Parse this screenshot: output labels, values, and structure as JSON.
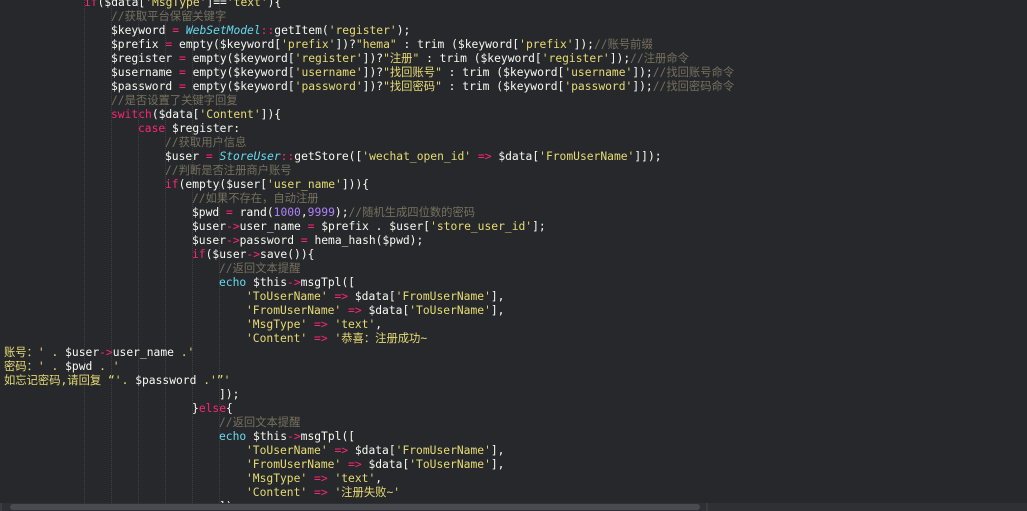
{
  "editor": {
    "lines": [
      {
        "tokens": [
          {
            "c": "t-kw",
            "t": "if"
          },
          {
            "c": "t-plain",
            "t": "($data["
          },
          {
            "c": "t-str",
            "t": "'MsgType'"
          },
          {
            "c": "t-plain",
            "t": "]=="
          },
          {
            "c": "t-str",
            "t": "'text'"
          },
          {
            "c": "t-plain",
            "t": "){"
          }
        ]
      },
      {
        "tokens": [
          {
            "c": "t-cmt",
            "t": "//获取平台保留关键字"
          }
        ]
      },
      {
        "tokens": [
          {
            "c": "t-plain",
            "t": "$keyword "
          },
          {
            "c": "t-op",
            "t": "="
          },
          {
            "c": "t-plain",
            "t": " "
          },
          {
            "c": "t-cls",
            "t": "WebSetModel"
          },
          {
            "c": "t-op",
            "t": "::"
          },
          {
            "c": "t-plain",
            "t": "getItem("
          },
          {
            "c": "t-str",
            "t": "'register'"
          },
          {
            "c": "t-plain",
            "t": ");"
          }
        ]
      },
      {
        "tokens": [
          {
            "c": "t-plain",
            "t": "$prefix "
          },
          {
            "c": "t-op",
            "t": "="
          },
          {
            "c": "t-plain",
            "t": " empty($keyword["
          },
          {
            "c": "t-str",
            "t": "'prefix'"
          },
          {
            "c": "t-plain",
            "t": "])?"
          },
          {
            "c": "t-str",
            "t": "\"hema\""
          },
          {
            "c": "t-plain",
            "t": " : trim ($keyword["
          },
          {
            "c": "t-str",
            "t": "'prefix'"
          },
          {
            "c": "t-plain",
            "t": "]);"
          },
          {
            "c": "t-cmt",
            "t": "//账号前缀"
          }
        ]
      },
      {
        "tokens": [
          {
            "c": "t-plain",
            "t": "$register "
          },
          {
            "c": "t-op",
            "t": "="
          },
          {
            "c": "t-plain",
            "t": " empty($keyword["
          },
          {
            "c": "t-str",
            "t": "'register'"
          },
          {
            "c": "t-plain",
            "t": "])?"
          },
          {
            "c": "t-str",
            "t": "\"注册\""
          },
          {
            "c": "t-plain",
            "t": " : trim ($keyword["
          },
          {
            "c": "t-str",
            "t": "'register'"
          },
          {
            "c": "t-plain",
            "t": "]);"
          },
          {
            "c": "t-cmt",
            "t": "//注册命令"
          }
        ]
      },
      {
        "tokens": [
          {
            "c": "t-plain",
            "t": "$username "
          },
          {
            "c": "t-op",
            "t": "="
          },
          {
            "c": "t-plain",
            "t": " empty($keyword["
          },
          {
            "c": "t-str",
            "t": "'username'"
          },
          {
            "c": "t-plain",
            "t": "])?"
          },
          {
            "c": "t-str",
            "t": "\"找回账号\""
          },
          {
            "c": "t-plain",
            "t": " : trim ($keyword["
          },
          {
            "c": "t-str",
            "t": "'username'"
          },
          {
            "c": "t-plain",
            "t": "]);"
          },
          {
            "c": "t-cmt",
            "t": "//找回账号命令"
          }
        ]
      },
      {
        "tokens": [
          {
            "c": "t-plain",
            "t": "$password "
          },
          {
            "c": "t-op",
            "t": "="
          },
          {
            "c": "t-plain",
            "t": " empty($keyword["
          },
          {
            "c": "t-str",
            "t": "'password'"
          },
          {
            "c": "t-plain",
            "t": "])?"
          },
          {
            "c": "t-str",
            "t": "\"找回密码\""
          },
          {
            "c": "t-plain",
            "t": " : trim ($keyword["
          },
          {
            "c": "t-str",
            "t": "'password'"
          },
          {
            "c": "t-plain",
            "t": "]);"
          },
          {
            "c": "t-cmt",
            "t": "//找回密码命令"
          }
        ]
      },
      {
        "tokens": [
          {
            "c": "t-cmt",
            "t": "//是否设置了关键字回复"
          }
        ]
      },
      {
        "tokens": [
          {
            "c": "t-kw",
            "t": "switch"
          },
          {
            "c": "t-plain",
            "t": "($data["
          },
          {
            "c": "t-str",
            "t": "'Content'"
          },
          {
            "c": "t-plain",
            "t": "]){"
          }
        ]
      },
      {
        "tokens": [
          {
            "c": "t-kw",
            "t": "case"
          },
          {
            "c": "t-plain",
            "t": " $register:"
          }
        ]
      },
      {
        "tokens": [
          {
            "c": "t-cmt",
            "t": "//获取用户信息"
          }
        ]
      },
      {
        "tokens": [
          {
            "c": "t-plain",
            "t": "$user "
          },
          {
            "c": "t-op",
            "t": "="
          },
          {
            "c": "t-plain",
            "t": " "
          },
          {
            "c": "t-cls",
            "t": "StoreUser"
          },
          {
            "c": "t-op",
            "t": "::"
          },
          {
            "c": "t-plain",
            "t": "getStore(["
          },
          {
            "c": "t-str",
            "t": "'wechat_open_id'"
          },
          {
            "c": "t-plain",
            "t": " "
          },
          {
            "c": "t-op",
            "t": "=>"
          },
          {
            "c": "t-plain",
            "t": " $data["
          },
          {
            "c": "t-str",
            "t": "'FromUserName'"
          },
          {
            "c": "t-plain",
            "t": "]]);"
          }
        ]
      },
      {
        "tokens": [
          {
            "c": "t-cmt",
            "t": "//判断是否注册商户账号"
          }
        ]
      },
      {
        "tokens": [
          {
            "c": "t-kw",
            "t": "if"
          },
          {
            "c": "t-plain",
            "t": "(empty($user["
          },
          {
            "c": "t-str",
            "t": "'user_name'"
          },
          {
            "c": "t-plain",
            "t": "])){"
          }
        ]
      },
      {
        "tokens": [
          {
            "c": "t-cmt",
            "t": "//如果不存在，自动注册"
          }
        ]
      },
      {
        "tokens": [
          {
            "c": "t-plain",
            "t": "$pwd "
          },
          {
            "c": "t-op",
            "t": "="
          },
          {
            "c": "t-plain",
            "t": " rand("
          },
          {
            "c": "t-num",
            "t": "1000"
          },
          {
            "c": "t-plain",
            "t": ","
          },
          {
            "c": "t-num",
            "t": "9999"
          },
          {
            "c": "t-plain",
            "t": ");"
          },
          {
            "c": "t-cmt",
            "t": "//随机生成四位数的密码"
          }
        ]
      },
      {
        "tokens": [
          {
            "c": "t-plain",
            "t": "$user"
          },
          {
            "c": "t-op",
            "t": "->"
          },
          {
            "c": "t-plain",
            "t": "user_name "
          },
          {
            "c": "t-op",
            "t": "="
          },
          {
            "c": "t-plain",
            "t": " $prefix . $user["
          },
          {
            "c": "t-str",
            "t": "'store_user_id'"
          },
          {
            "c": "t-plain",
            "t": "];"
          }
        ]
      },
      {
        "tokens": [
          {
            "c": "t-plain",
            "t": "$user"
          },
          {
            "c": "t-op",
            "t": "->"
          },
          {
            "c": "t-plain",
            "t": "password "
          },
          {
            "c": "t-op",
            "t": "="
          },
          {
            "c": "t-plain",
            "t": " hema_hash($pwd);"
          }
        ]
      },
      {
        "tokens": [
          {
            "c": "t-kw",
            "t": "if"
          },
          {
            "c": "t-plain",
            "t": "($user"
          },
          {
            "c": "t-op",
            "t": "->"
          },
          {
            "c": "t-plain",
            "t": "save()){"
          }
        ]
      },
      {
        "tokens": [
          {
            "c": "t-cmt",
            "t": "//返回文本提醒"
          }
        ]
      },
      {
        "tokens": [
          {
            "c": "t-blue",
            "t": "echo"
          },
          {
            "c": "t-plain",
            "t": " $this"
          },
          {
            "c": "t-op",
            "t": "->"
          },
          {
            "c": "t-plain",
            "t": "msgTpl(["
          }
        ]
      },
      {
        "tokens": [
          {
            "c": "t-str",
            "t": "'ToUserName'"
          },
          {
            "c": "t-plain",
            "t": " "
          },
          {
            "c": "t-op",
            "t": "=>"
          },
          {
            "c": "t-plain",
            "t": " $data["
          },
          {
            "c": "t-str",
            "t": "'FromUserName'"
          },
          {
            "c": "t-plain",
            "t": "],"
          }
        ]
      },
      {
        "tokens": [
          {
            "c": "t-str",
            "t": "'FromUserName'"
          },
          {
            "c": "t-plain",
            "t": " "
          },
          {
            "c": "t-op",
            "t": "=>"
          },
          {
            "c": "t-plain",
            "t": " $data["
          },
          {
            "c": "t-str",
            "t": "'ToUserName'"
          },
          {
            "c": "t-plain",
            "t": "],"
          }
        ]
      },
      {
        "tokens": [
          {
            "c": "t-str",
            "t": "'MsgType'"
          },
          {
            "c": "t-plain",
            "t": " "
          },
          {
            "c": "t-op",
            "t": "=>"
          },
          {
            "c": "t-plain",
            "t": " "
          },
          {
            "c": "t-str",
            "t": "'text'"
          },
          {
            "c": "t-plain",
            "t": ","
          }
        ]
      },
      {
        "tokens": [
          {
            "c": "t-str",
            "t": "'Content'"
          },
          {
            "c": "t-plain",
            "t": " "
          },
          {
            "c": "t-op",
            "t": "=>"
          },
          {
            "c": "t-plain",
            "t": " "
          },
          {
            "c": "t-str",
            "t": "'恭喜：注册成功~"
          }
        ]
      },
      {
        "tokens": [
          {
            "c": "t-str",
            "t": "账号：' . "
          },
          {
            "c": "t-plain",
            "t": "$user"
          },
          {
            "c": "t-op",
            "t": "->"
          },
          {
            "c": "t-plain",
            "t": "user_name "
          },
          {
            "c": "t-str",
            "t": ".'"
          }
        ]
      },
      {
        "tokens": [
          {
            "c": "t-str",
            "t": "密码：' . "
          },
          {
            "c": "t-plain",
            "t": "$pwd"
          },
          {
            "c": "t-str",
            "t": " . '"
          }
        ]
      },
      {
        "tokens": [
          {
            "c": "t-str",
            "t": "如忘记密码,请回复 “'. "
          },
          {
            "c": "t-plain",
            "t": "$password"
          },
          {
            "c": "t-str",
            "t": " .'”'"
          }
        ]
      },
      {
        "tokens": [
          {
            "c": "t-plain",
            "t": "]);"
          }
        ]
      },
      {
        "tokens": [
          {
            "c": "t-plain",
            "t": "}"
          },
          {
            "c": "t-kw",
            "t": "else"
          },
          {
            "c": "t-plain",
            "t": "{"
          }
        ]
      },
      {
        "tokens": [
          {
            "c": "t-cmt",
            "t": "//返回文本提醒"
          }
        ]
      },
      {
        "tokens": [
          {
            "c": "t-blue",
            "t": "echo"
          },
          {
            "c": "t-plain",
            "t": " $this"
          },
          {
            "c": "t-op",
            "t": "->"
          },
          {
            "c": "t-plain",
            "t": "msgTpl(["
          }
        ]
      },
      {
        "tokens": [
          {
            "c": "t-str",
            "t": "'ToUserName'"
          },
          {
            "c": "t-plain",
            "t": " "
          },
          {
            "c": "t-op",
            "t": "=>"
          },
          {
            "c": "t-plain",
            "t": " $data["
          },
          {
            "c": "t-str",
            "t": "'FromUserName'"
          },
          {
            "c": "t-plain",
            "t": "],"
          }
        ]
      },
      {
        "tokens": [
          {
            "c": "t-str",
            "t": "'FromUserName'"
          },
          {
            "c": "t-plain",
            "t": " "
          },
          {
            "c": "t-op",
            "t": "=>"
          },
          {
            "c": "t-plain",
            "t": " $data["
          },
          {
            "c": "t-str",
            "t": "'ToUserName'"
          },
          {
            "c": "t-plain",
            "t": "],"
          }
        ]
      },
      {
        "tokens": [
          {
            "c": "t-str",
            "t": "'MsgType'"
          },
          {
            "c": "t-plain",
            "t": " "
          },
          {
            "c": "t-op",
            "t": "=>"
          },
          {
            "c": "t-plain",
            "t": " "
          },
          {
            "c": "t-str",
            "t": "'text'"
          },
          {
            "c": "t-plain",
            "t": ","
          }
        ]
      },
      {
        "tokens": [
          {
            "c": "t-str",
            "t": "'Content'"
          },
          {
            "c": "t-plain",
            "t": " "
          },
          {
            "c": "t-op",
            "t": "=>"
          },
          {
            "c": "t-plain",
            "t": " "
          },
          {
            "c": "t-str",
            "t": "'注册失败~'"
          }
        ]
      },
      {
        "tokens": [
          {
            "c": "t-plain",
            "t": "]);"
          }
        ]
      }
    ]
  },
  "colors": {
    "background": "#27282b",
    "string": "#e6db74",
    "comment": "#75715e",
    "keyword": "#f92672",
    "class": "#66d9ef",
    "number": "#ae81ff",
    "text": "#f8f8f2"
  }
}
